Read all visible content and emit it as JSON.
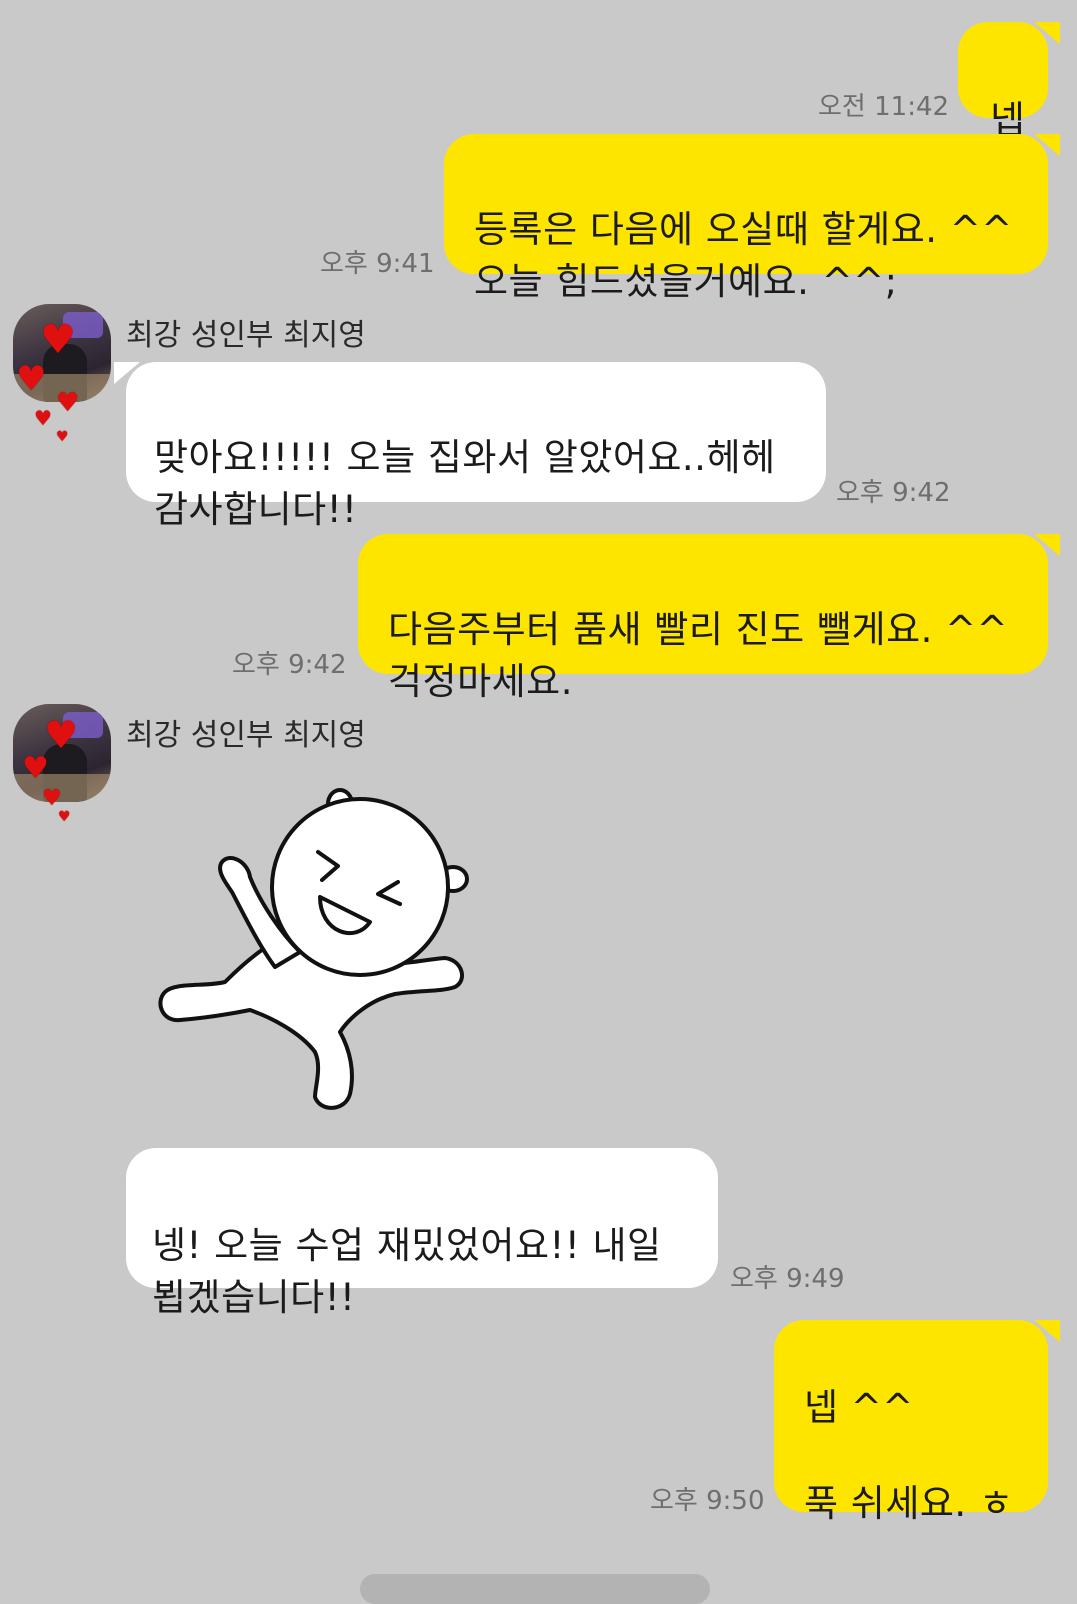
{
  "messages": [
    {
      "id": "m1",
      "side": "me",
      "text": "넵",
      "time": "오전 11:42"
    },
    {
      "id": "m2",
      "side": "me",
      "text": "등록은 다음에 오실때 할게요. ^^\n오늘 힘드셨을거예요. ^^;",
      "time": "오후 9:41"
    },
    {
      "id": "m3",
      "side": "other",
      "sender": "최강 성인부 최지영",
      "text": "맞아요!!!!! 오늘 집와서 알았어요..헤헤\n감사합니다!!",
      "time": "오후 9:42"
    },
    {
      "id": "m4",
      "side": "me",
      "text": "다음주부터 품새 빨리 진도 뺄게요. ^^\n걱정마세요.",
      "time": "오후 9:42"
    },
    {
      "id": "m5",
      "side": "other",
      "sender": "최강 성인부 최지영",
      "sticker": "laughing-white-character-sticker"
    },
    {
      "id": "m6",
      "side": "other",
      "text": "넹! 오늘 수업 재밌었어요!! 내일\n뵙겠습니다!!",
      "time": "오후 9:49"
    },
    {
      "id": "m7",
      "side": "me",
      "text": "넵 ^^\n\n푹 쉬세요. ㅎ",
      "time": "오후 9:50"
    }
  ],
  "colors": {
    "background": "#c9c9c9",
    "my_bubble": "#fee500",
    "other_bubble": "#ffffff",
    "timestamp": "#6e6e6e",
    "heart": "#e01010"
  },
  "icons": {
    "avatar_decoration": "heart-icon"
  }
}
